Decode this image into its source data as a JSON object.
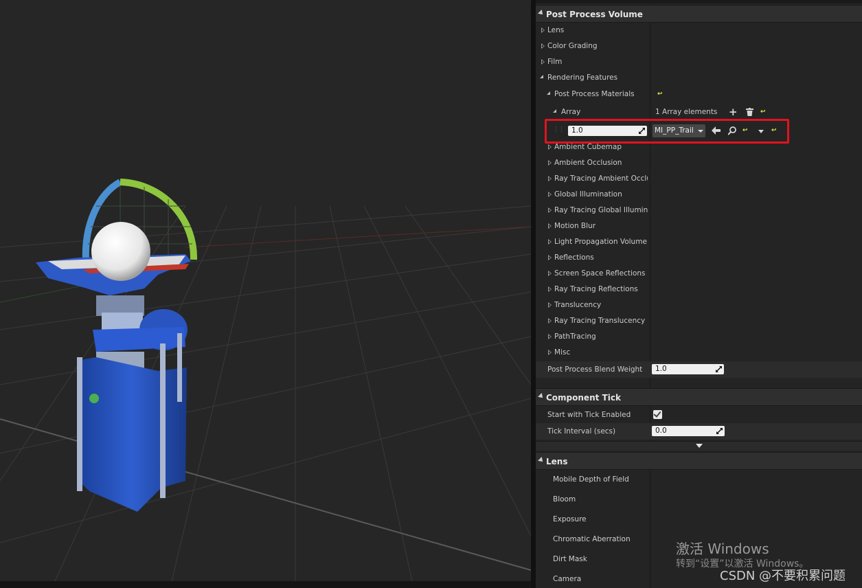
{
  "panel": {
    "post_process_volume": {
      "title": "Post Process Volume",
      "items": [
        "Lens",
        "Color Grading",
        "Film",
        "Rendering Features"
      ],
      "ppm_label": "Post Process Materials",
      "array_label": "Array",
      "array_count": "1 Array elements",
      "element_weight": "1.0",
      "element_material": "MI_PP_Trail",
      "features": [
        "Ambient Cubemap",
        "Ambient Occlusion",
        "Ray Tracing Ambient Occlu",
        "Global Illumination",
        "Ray Tracing Global Illumina",
        "Motion Blur",
        "Light Propagation Volume",
        "Reflections",
        "Screen Space Reflections",
        "Ray Tracing Reflections",
        "Translucency",
        "Ray Tracing Translucency",
        "PathTracing",
        "Misc"
      ],
      "blend_weight_label": "Post Process Blend Weight",
      "blend_weight_value": "1.0"
    },
    "component_tick": {
      "title": "Component Tick",
      "start_with_tick_label": "Start with Tick Enabled",
      "start_with_tick_checked": true,
      "tick_interval_label": "Tick Interval (secs)",
      "tick_interval_value": "0.0"
    },
    "lens": {
      "title": "Lens",
      "items": [
        "Mobile Depth of Field",
        "Bloom",
        "Exposure",
        "Chromatic Aberration",
        "Dirt Mask",
        "Camera"
      ]
    }
  },
  "watermark": {
    "line1": "激活 Windows",
    "line2": "转到“设置”以激活 Windows。",
    "credit": "CSDN @不要积累问题"
  },
  "colors": {
    "highlight": "#e0141e",
    "reset_arrow": "#e8e84a",
    "gizmo_blue": "#4a90d0",
    "gizmo_green": "#8ec63f",
    "gizmo_red": "#c0392b"
  }
}
